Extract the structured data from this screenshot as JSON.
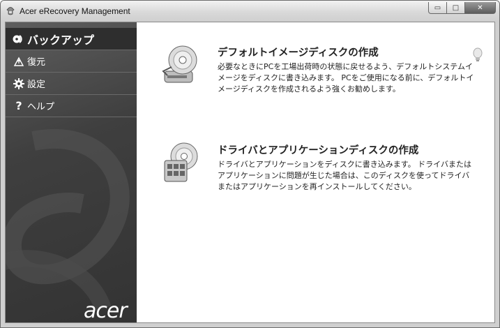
{
  "window": {
    "title": "Acer eRecovery Management",
    "buttons": {
      "minimize": "▭",
      "maximize": "□",
      "close": "✕"
    }
  },
  "sidebar": {
    "items": [
      {
        "label": "バックアップ",
        "icon": "backup-disc-icon",
        "active": true
      },
      {
        "label": "復元",
        "icon": "restore-icon",
        "active": false
      },
      {
        "label": "設定",
        "icon": "gear-icon",
        "active": false
      },
      {
        "label": "ヘルプ",
        "icon": "question-mark-icon",
        "active": false
      }
    ],
    "brand": "acer"
  },
  "main": {
    "options": [
      {
        "title": "デフォルトイメージディスクの作成",
        "description": "必要なときにPCを工場出荷時の状態に戻せるよう、デフォルトシステムイメージをディスクに書き込みます。 PCをご使用になる前に、デフォルトイメージディスクを作成されるよう強くお勧めします。",
        "icon": "disc-drive-icon"
      },
      {
        "title": "ドライバとアプリケーションディスクの作成",
        "description": "ドライバとアプリケーションをディスクに書き込みます。 ドライバまたはアプリケーションに問題が生じた場合は、このディスクを使ってドライバまたはアプリケーションを再インストールしてください。",
        "icon": "disc-applications-icon"
      }
    ],
    "hint_icon": "lightbulb-icon"
  },
  "colors": {
    "sidebar_bg": "#3f3f3f",
    "sidebar_active": "#2e2e2e",
    "content_bg": "#ffffff",
    "text": "#222222"
  }
}
